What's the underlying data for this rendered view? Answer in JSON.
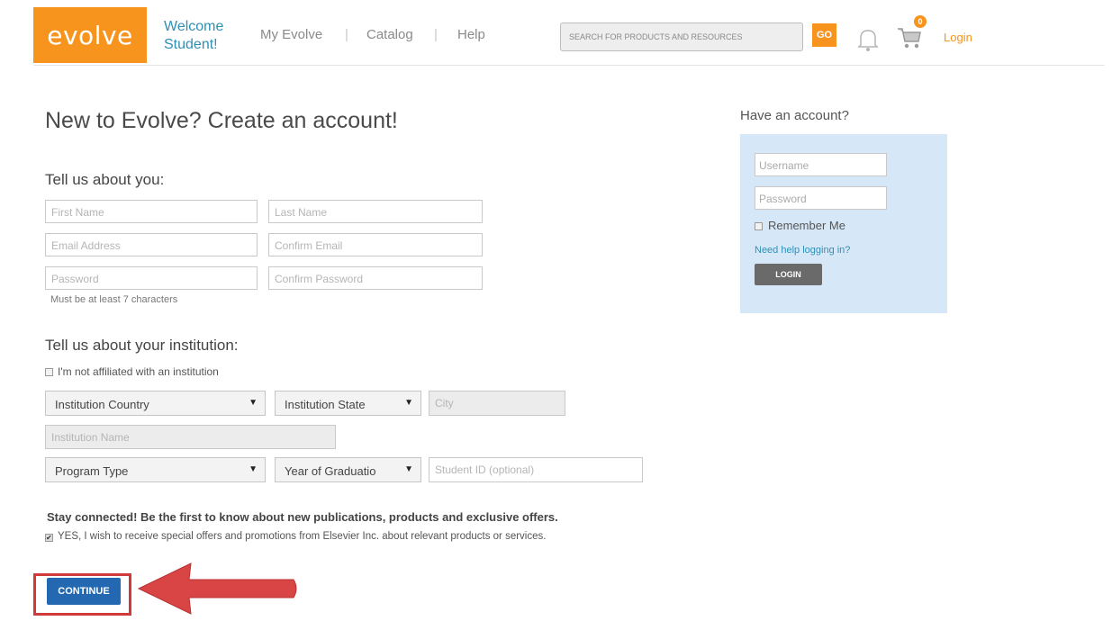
{
  "header": {
    "logo": "evolve",
    "welcome_line1": "Welcome",
    "welcome_line2": "Student!",
    "nav": [
      "My Evolve",
      "Catalog",
      "Help"
    ],
    "nav_separator": "|",
    "search_placeholder": "SEARCH FOR PRODUCTS AND RESOURCES",
    "go_label": "GO",
    "cart_count": "0",
    "login_label": "Login"
  },
  "form": {
    "title": "New to Evolve? Create an account!",
    "about_you_heading": "Tell us about you:",
    "first_name": "First Name",
    "last_name": "Last Name",
    "email": "Email Address",
    "confirm_email": "Confirm Email",
    "password": "Password",
    "confirm_password": "Confirm Password",
    "password_hint": "Must be at least 7 characters",
    "institution_heading": "Tell us about your institution:",
    "not_affiliated": "I'm not affiliated with an institution",
    "institution_country": "Institution Country",
    "institution_state": "Institution State",
    "city": "City",
    "institution_name": "Institution Name",
    "program_type": "Program Type",
    "year_of_graduation": "Year of Graduatio",
    "student_id": "Student ID (optional)",
    "stay_connected": "Stay connected! Be the first to know about new publications, products and exclusive offers.",
    "offers_checkbox": "YES, I wish to receive special offers and promotions from Elsevier Inc. about relevant products or services.",
    "offers_checked": true,
    "continue_label": "CONTINUE"
  },
  "login_panel": {
    "heading": "Have an account?",
    "username": "Username",
    "password": "Password",
    "remember_me": "Remember Me",
    "need_help": "Need help logging in?",
    "login_button": "LOGIN"
  },
  "colors": {
    "brand_orange": "#f7941d",
    "link_blue": "#2f8fb6",
    "continue_blue": "#2368b0",
    "highlight_red": "#d13a3a",
    "panel_blue": "#d6e8f7"
  }
}
